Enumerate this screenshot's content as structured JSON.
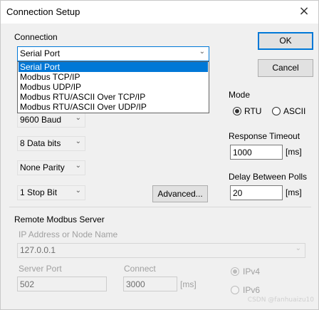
{
  "window": {
    "title": "Connection Setup",
    "close_glyph": "×"
  },
  "connection": {
    "group_label": "Connection",
    "selected": "Serial Port",
    "options": [
      "Serial Port",
      "Modbus TCP/IP",
      "Modbus UDP/IP",
      "Modbus RTU/ASCII Over TCP/IP",
      "Modbus RTU/ASCII Over UDP/IP"
    ],
    "baud": "9600 Baud",
    "data_bits": "8 Data bits",
    "parity": "None Parity",
    "stop_bits": "1 Stop Bit",
    "advanced_label": "Advanced..."
  },
  "buttons": {
    "ok": "OK",
    "cancel": "Cancel"
  },
  "mode": {
    "label": "Mode",
    "rtu": "RTU",
    "ascii": "ASCII",
    "selected": "RTU"
  },
  "response_timeout": {
    "label": "Response Timeout",
    "value": "1000",
    "unit": "[ms]"
  },
  "delay_between_polls": {
    "label": "Delay Between Polls",
    "value": "20",
    "unit": "[ms]"
  },
  "remote_server": {
    "group_label": "Remote Modbus Server",
    "ip_label": "IP Address or Node Name",
    "ip_value": "127.0.0.1",
    "server_port_label": "Server Port",
    "server_port_value": "502",
    "connect_label": "Connect",
    "connect_value": "3000",
    "connect_unit": "[ms]",
    "ipv4_label": "IPv4",
    "ipv6_label": "IPv6",
    "ip_version_selected": "IPv4"
  },
  "watermark": "CSDN @fanhuaizu10",
  "colors": {
    "accent": "#0078d7",
    "disabled_text": "#a0a0a0"
  }
}
